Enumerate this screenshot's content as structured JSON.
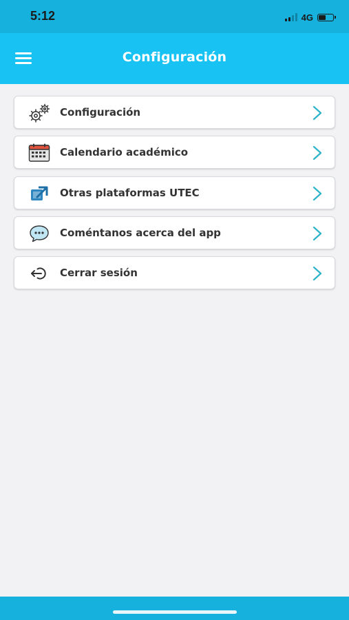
{
  "status_bar": {
    "time": "5:12",
    "network": "4G"
  },
  "header": {
    "title": "Configuración"
  },
  "menu_items": [
    {
      "label": "Configuración",
      "icon": "gears-icon"
    },
    {
      "label": "Calendario académico",
      "icon": "calendar-icon"
    },
    {
      "label": "Otras plataformas UTEC",
      "icon": "external-link-icon"
    },
    {
      "label": "Coméntanos acerca del app",
      "icon": "chat-bubble-icon"
    },
    {
      "label": "Cerrar sesión",
      "icon": "logout-icon"
    }
  ],
  "colors": {
    "status_bar_bg": "#17b1de",
    "header_bg": "#18c2f3",
    "chevron": "#2ab3c9",
    "page_bg": "#f2f2f4",
    "label_text": "#333333"
  }
}
